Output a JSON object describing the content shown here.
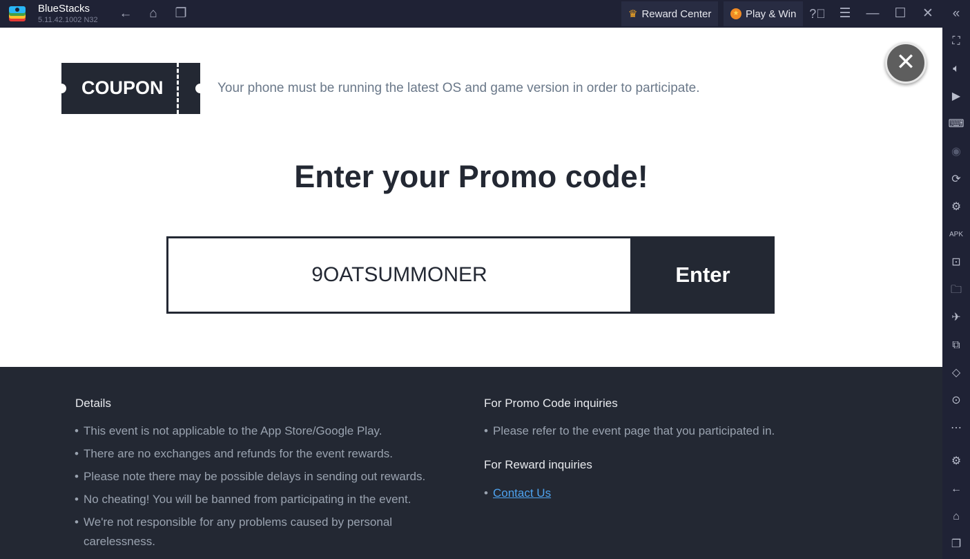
{
  "titlebar": {
    "app_name": "BlueStacks",
    "version": "5.11.42.1002  N32",
    "reward_center": "Reward Center",
    "play_win": "Play & Win"
  },
  "main": {
    "coupon_label": "COUPON",
    "notice": "Your phone must be running the latest OS and game version in order to participate.",
    "heading": "Enter your Promo code!",
    "code_value": "9OATSUMMONER",
    "enter_label": "Enter"
  },
  "footer": {
    "details_title": "Details",
    "details": [
      "This event is not applicable to the App Store/Google Play.",
      "There are no exchanges and refunds for the event rewards.",
      "Please note there may be possible delays in sending out rewards.",
      "No cheating! You will be banned from participating in the event.",
      "We're not responsible for any problems caused by personal carelessness."
    ],
    "promo_title": "For Promo Code inquiries",
    "promo_items": [
      "Please refer to the event page that you participated in."
    ],
    "reward_title": "For Reward inquiries",
    "contact_label": "Contact Us"
  }
}
